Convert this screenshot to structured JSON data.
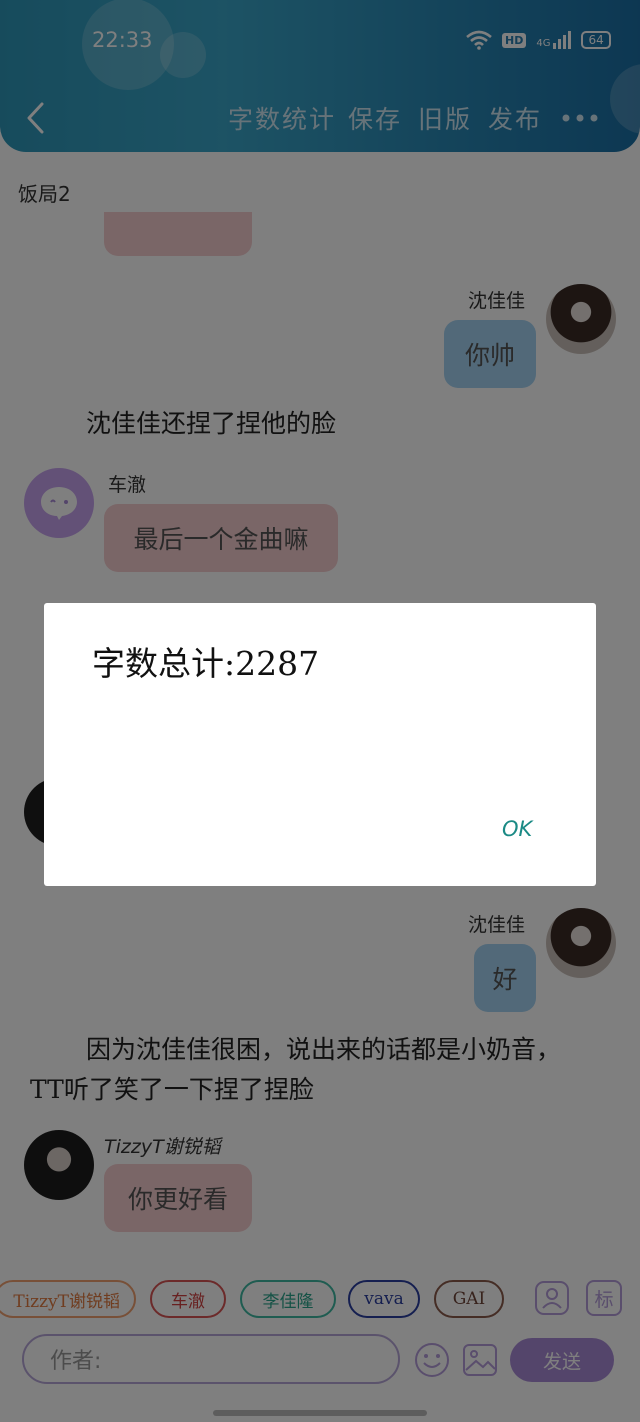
{
  "status": {
    "time": "22:33",
    "battery": "64",
    "network": "4G",
    "hd": "HD"
  },
  "header": {
    "word_count": "字数统计",
    "save": "保存",
    "old_version": "旧版",
    "publish": "发布"
  },
  "chat": {
    "title": "饭局2",
    "msg1": {
      "name": "沈佳佳",
      "text": "你帅"
    },
    "narr1": "沈佳佳还捏了捏他的脸",
    "msg2": {
      "name": "车澈",
      "text": "最后一个金曲嘛"
    },
    "msg3": {
      "name": "沈佳佳",
      "text": "好"
    },
    "narr2": "因为沈佳佳很困，说出来的话都是小奶音，TT听了笑了一下捏了捏脸",
    "msg4": {
      "name": "TizzyT谢锐韬",
      "text": "你更好看"
    }
  },
  "dialog": {
    "message": "字数总计:2287",
    "ok": "OK"
  },
  "tags": [
    "TizzyT谢锐韬",
    "车澈",
    "李佳隆",
    "vava",
    "GAI"
  ],
  "tag_icon_label": "标",
  "composer": {
    "placeholder": "作者:",
    "send": "发送"
  },
  "colors": {
    "accent_purple": "#a98bd6",
    "bubble_blue": "#a5d3f2",
    "bubble_pink": "#f5cccf",
    "ok_green": "#1b8a85"
  }
}
